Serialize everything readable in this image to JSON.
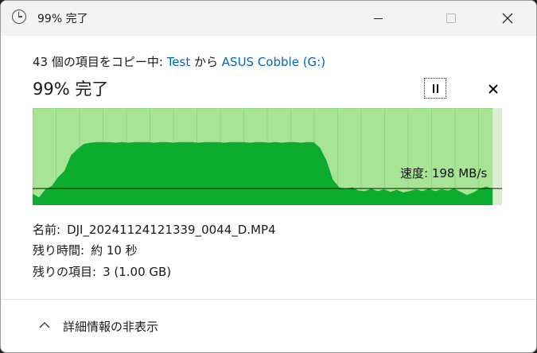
{
  "window": {
    "title": "99% 完了"
  },
  "header": {
    "prefix": "43 個の項目をコピー中: ",
    "source": "Test",
    "middle": " から ",
    "destination": "ASUS Cobble (G:)",
    "status": "99% 完了"
  },
  "graph": {
    "speed_label": "速度: 198 MB/s",
    "fill_color": "#0cac2e",
    "background_color": "#a8e495",
    "line_color": "#111111",
    "progress_fraction": 0.99,
    "current_speed_mb_s": 198,
    "speed_history": [
      18,
      12,
      25,
      30,
      44,
      54,
      78,
      88,
      96,
      98,
      99,
      99,
      99,
      98,
      99,
      98,
      99,
      99,
      99,
      98,
      99,
      99,
      98,
      99,
      99,
      99,
      98,
      99,
      99,
      99,
      98,
      99,
      99,
      99,
      98,
      99,
      99,
      98,
      99,
      98,
      99,
      99,
      98,
      99,
      99,
      90,
      70,
      40,
      28,
      25,
      28,
      23,
      22,
      26,
      22,
      25,
      21,
      24,
      20,
      22,
      25,
      22,
      26,
      22,
      25,
      23,
      26,
      21,
      16,
      20,
      26,
      29,
      26
    ]
  },
  "info": {
    "name_label": "名前:",
    "name_value": "DJI_20241124121339_0044_D.MP4",
    "time_label": "残り時間:",
    "time_value": "約 10 秒",
    "items_label": "残りの項目:",
    "items_value": "3 (1.00 GB)"
  },
  "footer": {
    "toggle_label": "詳細情報の非表示"
  }
}
